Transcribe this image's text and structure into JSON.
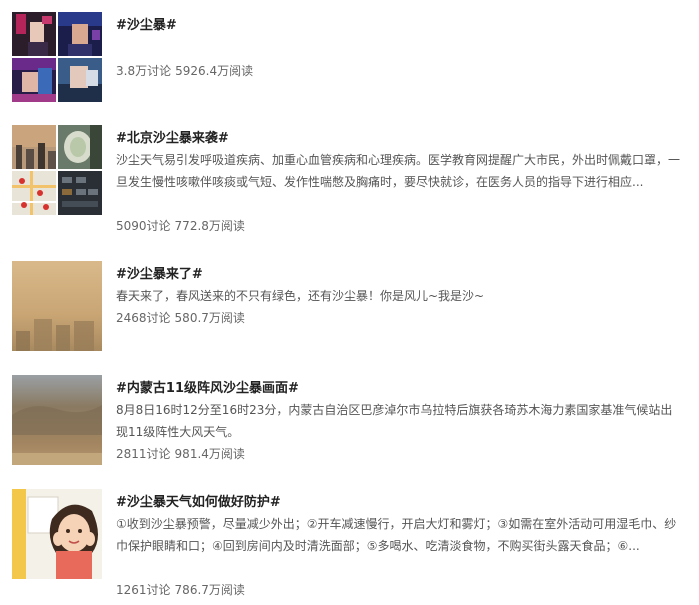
{
  "topics": [
    {
      "title": "#沙尘暴#",
      "description": "",
      "discussions": "3.8万讨论",
      "reads": "5926.4万阅读"
    },
    {
      "title": "#北京沙尘暴来袭#",
      "description": "沙尘天气易引发呼吸道疾病、加重心血管疾病和心理疾病。医学教育网提醒广大市民，外出时佩戴口罩，一旦发生慢性咳嗽伴咳痰或气短、发作性喘憋及胸痛时，要尽快就诊，在医务人员的指导下进行相应...",
      "discussions": "5090讨论",
      "reads": "772.8万阅读"
    },
    {
      "title": "#沙尘暴来了#",
      "description": "春天来了，春风送来的不只有绿色，还有沙尘暴！你是风儿~我是沙~",
      "discussions": "2468讨论",
      "reads": "580.7万阅读"
    },
    {
      "title": "#内蒙古11级阵风沙尘暴画面#",
      "description": "8月8日16时12分至16时23分，内蒙古自治区巴彦淖尔市乌拉特后旗获各琦苏木海力素国家基准气候站出现11级阵性大风天气。",
      "discussions": "2811讨论",
      "reads": "981.4万阅读"
    },
    {
      "title": "#沙尘暴天气如何做好防护#",
      "description": "①收到沙尘暴预警，尽量减少外出；②开车减速慢行，开启大灯和雾灯；③如需在室外活动可用湿毛巾、纱巾保护眼睛和口；④回到房间内及时清洗面部；⑤多喝水、吃清淡食物，不购买街头露天食品；⑥...",
      "discussions": "1261讨论",
      "reads": "786.7万阅读"
    }
  ]
}
